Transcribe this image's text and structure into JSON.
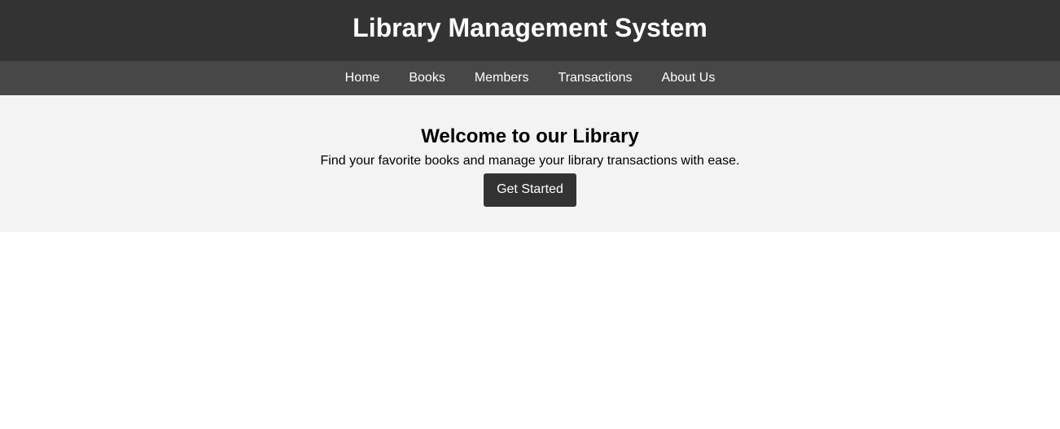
{
  "header": {
    "title": "Library Management System"
  },
  "nav": {
    "items": [
      {
        "label": "Home"
      },
      {
        "label": "Books"
      },
      {
        "label": "Members"
      },
      {
        "label": "Transactions"
      },
      {
        "label": "About Us"
      }
    ]
  },
  "hero": {
    "title": "Welcome to our Library",
    "subtitle": "Find your favorite books and manage your library transactions with ease.",
    "cta_label": "Get Started"
  },
  "colors": {
    "header_bg": "#333333",
    "nav_bg": "#474747",
    "hero_bg": "#f3f3f3",
    "button_bg": "#333333"
  }
}
